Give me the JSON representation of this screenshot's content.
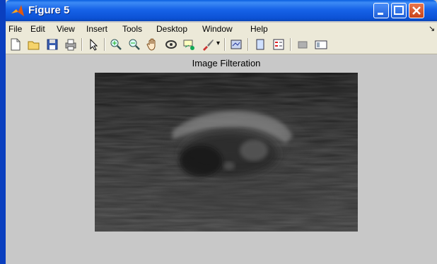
{
  "window": {
    "title": "Figure 5"
  },
  "menu": {
    "items": [
      {
        "label": "File"
      },
      {
        "label": "Edit"
      },
      {
        "label": "View"
      },
      {
        "label": "Insert"
      },
      {
        "label": "Tools"
      },
      {
        "label": "Desktop"
      },
      {
        "label": "Window"
      },
      {
        "label": "Help"
      }
    ]
  },
  "toolbar": {
    "buttons": [
      "new-figure-icon",
      "open-file-icon",
      "save-icon",
      "print-icon",
      "pointer-icon",
      "zoom-in-icon",
      "zoom-out-icon",
      "pan-hand-icon",
      "rotate-3d-icon",
      "data-cursor-icon",
      "brush-icon",
      "link-plot-icon",
      "colorbar-icon",
      "legend-icon",
      "hide-plot-tools-icon",
      "show-plot-tools-icon"
    ]
  },
  "axes": {
    "title": "Image Filteration"
  },
  "colors": {
    "titlebar": "#0c52d6",
    "figure_bg": "#c8c8c8",
    "menubar": "#ece9d8"
  }
}
